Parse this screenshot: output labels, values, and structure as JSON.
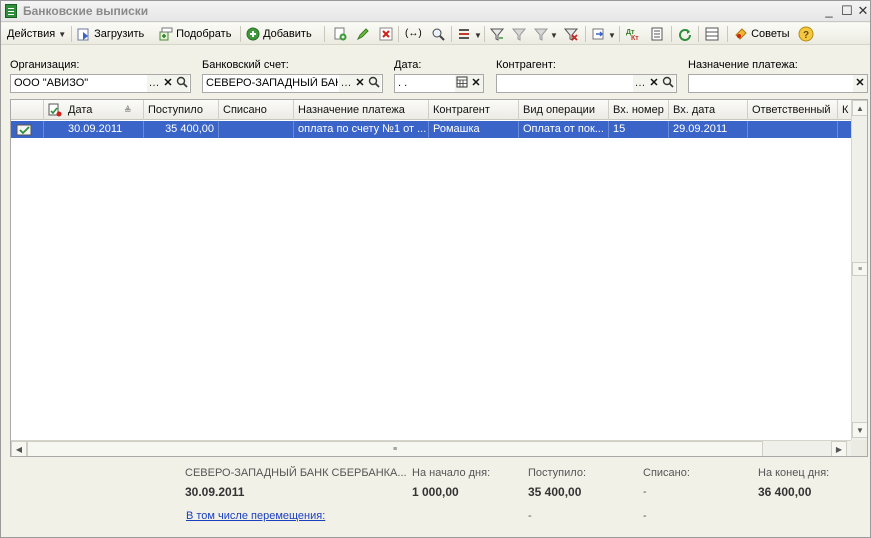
{
  "window": {
    "title": "Банковские выписки"
  },
  "toolbar": {
    "actions": "Действия",
    "load": "Загрузить",
    "select": "Подобрать",
    "add": "Добавить",
    "tips": "Советы"
  },
  "filters": {
    "org_label": "Организация:",
    "org_value": "ООО \"АВИЗО\"",
    "account_label": "Банковский счет:",
    "account_value": "СЕВЕРО-ЗАПАДНЫЙ БАНК",
    "date_label": "Дата:",
    "date_value": " .  .",
    "counterparty_label": "Контрагент:",
    "counterparty_value": "",
    "purpose_label": "Назначение платежа:",
    "purpose_value": ""
  },
  "table": {
    "columns": [
      "Дата",
      "Поступило",
      "Списано",
      "Назначение платежа",
      "Контрагент",
      "Вид операции",
      "Вх. номер",
      "Вх. дата",
      "Ответственный",
      "К"
    ],
    "rows": [
      {
        "date": "30.09.2011",
        "received": "35 400,00",
        "written_off": "",
        "purpose": "оплата по счету №1 от ...",
        "counterparty": "Ромашка",
        "operation": "Оплата от пок...",
        "in_number": "15",
        "in_date": "29.09.2011",
        "responsible": ""
      }
    ]
  },
  "totals": {
    "bank": "СЕВЕРО-ЗАПАДНЫЙ БАНК СБЕРБАНКА...",
    "date": "30.09.2011",
    "start_label": "На начало дня:",
    "start_value": "1 000,00",
    "received_label": "Поступило:",
    "received_value": "35 400,00",
    "received_transfers": "-",
    "written_label": "Списано:",
    "written_value": "-",
    "written_transfers": "-",
    "end_label": "На конец дня:",
    "end_value": "36 400,00",
    "transfers_link": "В том числе перемещения:"
  },
  "icons": {
    "accent": "#3a64c8"
  }
}
